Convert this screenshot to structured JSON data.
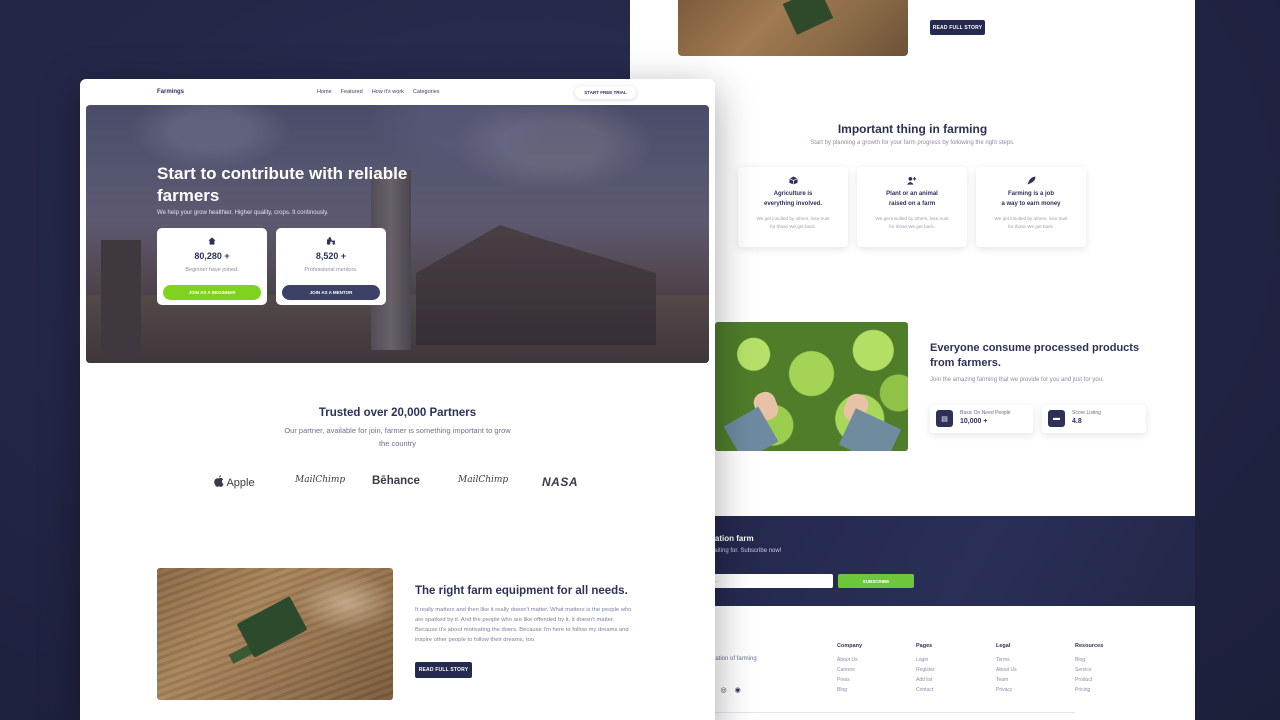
{
  "back": {
    "read_full_story": "READ FULL STORY",
    "important": {
      "title": "Important thing in farming",
      "subtitle": "Start by planning a growth for your farm progress by following the right steps.",
      "features": [
        {
          "icon": "box-icon",
          "title": "Agriculture is\neverything involved.",
          "desc": "We get insulted by others, lose trust\nfor those We get back."
        },
        {
          "icon": "user-add-icon",
          "title": "Plant or an animal\nraised on a farm",
          "desc": "We get insulted by others, lose trust\nfor those We get back."
        },
        {
          "icon": "rocket-icon",
          "title": "Farming is a job\na way to earn money",
          "desc": "We get insulted by others, lose trust\nfor those We get back."
        }
      ]
    },
    "consume": {
      "title": "Everyone consume processed products from farmers.",
      "subtitle": "Join the amazing farming that we provide for you and just for you.",
      "stats": [
        {
          "icon": "document-icon",
          "label": "Basic On Need People",
          "value": "10,000 +"
        },
        {
          "icon": "card-icon",
          "label": "Score Listing",
          "value": "4.8"
        }
      ]
    },
    "newsletter": {
      "title": "nation farm",
      "subtitle": "waiting for. Subscribe now!",
      "input_placeholder": "...",
      "button": "SUBSCRIBE"
    },
    "footer": {
      "tagline": "eration of farming",
      "columns": [
        {
          "heading": "Company",
          "links": [
            "About Us",
            "Careers",
            "Press",
            "Blog"
          ]
        },
        {
          "heading": "Pages",
          "links": [
            "Login",
            "Register",
            "Add list",
            "Contact"
          ]
        },
        {
          "heading": "Legal",
          "links": [
            "Terms",
            "About Us",
            "Team",
            "Privacy"
          ]
        },
        {
          "heading": "Resources",
          "links": [
            "Blog",
            "Service",
            "Product",
            "Pricing"
          ]
        }
      ]
    }
  },
  "front": {
    "nav": {
      "logo": "Farmings",
      "links": [
        "Home",
        "Featured",
        "How it's work",
        "Categories"
      ],
      "cta": "START FREE TRIAL"
    },
    "hero": {
      "title": "Start to contribute with reliable farmers",
      "subtitle": "We help your grow healthier. Higher quality, crops. It continously.",
      "cards": [
        {
          "icon": "house-icon",
          "value": "80,280 +",
          "label": "Beginner have joined.",
          "button": "JOIN AS A BEGINNER",
          "button_color": "#7ed321"
        },
        {
          "icon": "tractor-icon",
          "value": "8,520 +",
          "label": "Professional mentors.",
          "button": "JOIN AS A MENTOR",
          "button_color": "#3c4267"
        }
      ]
    },
    "partners": {
      "title": "Trusted over 20,000 Partners",
      "subtitle": "Our partner, available for join, farmer is something important to grow the country",
      "logos": [
        "Apple",
        "MailChimp",
        "Bēhance",
        "MailChimp",
        "NASA"
      ]
    },
    "equipment": {
      "title": "The right farm equipment for all needs.",
      "text": "It really matters and then like it really doesn't matter. What matters is the people who are sparked by it. And the people who are like offended by it, it doesn't matter. Because it's about motivating the doers. Because I'm here to follow my dreams and inspire other people to follow their dreams, too.",
      "button": "READ FULL STORY"
    }
  },
  "colors": {
    "background": "#212443",
    "navy": "#2d3158",
    "green": "#7ed321",
    "button_dark": "#252a4e"
  }
}
